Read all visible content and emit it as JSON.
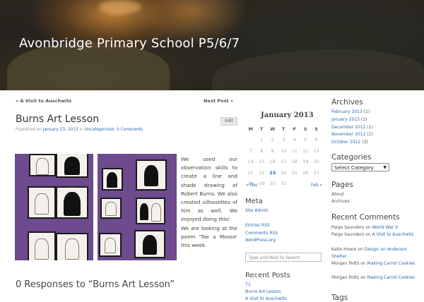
{
  "site": {
    "title": "Avonbridge Primary School P5/6/7"
  },
  "post_nav": {
    "prev": "« A Visit to Auschwitz",
    "next": "Next Post »"
  },
  "post": {
    "title": "Burns Art Lesson",
    "edit": "Edit",
    "meta_prefix": "Published on",
    "date": "January 23, 2013",
    "in": "in",
    "category": "Uncategorized",
    "comments": "0 Comments",
    "paragraph1": "We used our observation skills to create a line and shade drawing of Robert Burns. We also created silhouettes of him as well. We enjoyed doing this!",
    "paragraph2": "We are looking at the poem 'Tae a Moose' this week.",
    "responses": "0 Responses to “Burns Art Lesson”"
  },
  "calendar": {
    "title": "January 2013",
    "days": [
      "M",
      "T",
      "W",
      "T",
      "F",
      "S",
      "S"
    ],
    "rows": [
      [
        "",
        "1",
        "2",
        "3",
        "4",
        "5",
        "6"
      ],
      [
        "7",
        "8",
        "9",
        "10",
        "11",
        "12",
        "13"
      ],
      [
        "14",
        "15",
        "16",
        "17",
        "18",
        "19",
        "20"
      ],
      [
        "21",
        "22",
        "23",
        "24",
        "25",
        "26",
        "27"
      ],
      [
        "28",
        "29",
        "30",
        "31",
        "",
        "",
        ""
      ]
    ],
    "today": "23",
    "prev": "« Dec",
    "next": "Feb »"
  },
  "meta_widget": {
    "title": "Meta",
    "links": [
      "Site Admin",
      "Entries RSS",
      "Comments RSS",
      "WordPress.org"
    ]
  },
  "search": {
    "placeholder": "Type and Wait to Search"
  },
  "recent_posts": {
    "title": "Recent Posts",
    "items": [
      "71",
      "Burns Art Lesson",
      "A Visit to Auschwitz"
    ]
  },
  "archives": {
    "title": "Archives",
    "items": [
      {
        "label": "February 2013",
        "count": "(1)"
      },
      {
        "label": "January 2013",
        "count": "(1)"
      },
      {
        "label": "December 2012",
        "count": "(1)"
      },
      {
        "label": "November 2012",
        "count": "(1)"
      },
      {
        "label": "October 2012",
        "count": "(3)"
      }
    ]
  },
  "categories": {
    "title": "Categories",
    "select": "Select Category"
  },
  "pages": {
    "title": "Pages",
    "items": [
      "About",
      "Archives"
    ]
  },
  "recent_comments": {
    "title": "Recent Comments",
    "items": [
      {
        "author": "Paige Saunders",
        "on": "on",
        "post": "World War II"
      },
      {
        "author": "Paige Saunders",
        "on": "on",
        "post": "A Visit to Auschwitz"
      },
      {
        "author": "Katie Howie",
        "on": "on",
        "post": "Design an Anderson Shelter"
      },
      {
        "author": "Morgan Potts",
        "on": "on",
        "post": "Making Carrot Cookies"
      },
      {
        "author": "Morgan Potts",
        "on": "on",
        "post": "Making Carrot Cookies"
      }
    ]
  },
  "tags": {
    "title": "Tags"
  }
}
